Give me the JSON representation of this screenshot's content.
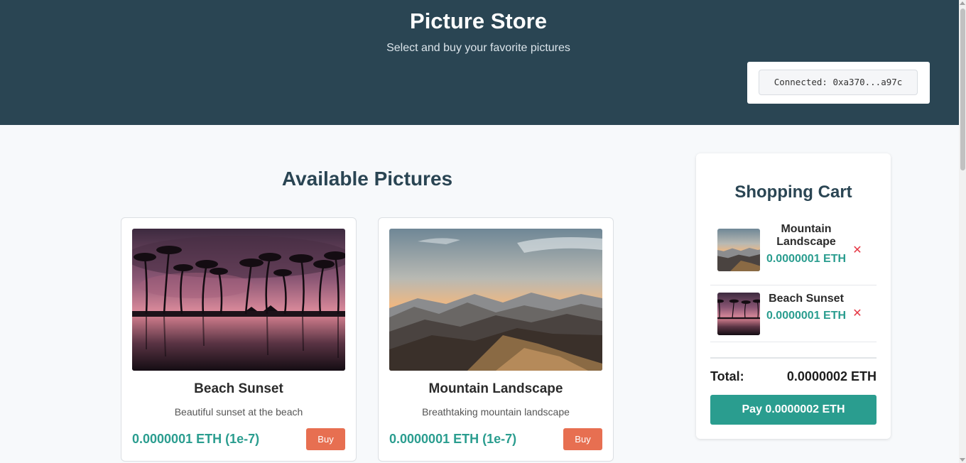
{
  "header": {
    "title": "Picture Store",
    "subtitle": "Select and buy your favorite pictures",
    "wallet_status": "Connected: 0xa370...a97c"
  },
  "catalog": {
    "title": "Available Pictures",
    "items": [
      {
        "name": "Beach Sunset",
        "description": "Beautiful sunset at the beach",
        "price": "0.0000001 ETH (1e-7)",
        "buy_label": "Buy"
      },
      {
        "name": "Mountain Landscape",
        "description": "Breathtaking mountain landscape",
        "price": "0.0000001 ETH (1e-7)",
        "buy_label": "Buy"
      }
    ]
  },
  "cart": {
    "title": "Shopping Cart",
    "items": [
      {
        "name": "Mountain Landscape",
        "price": "0.0000001 ETH",
        "remove_label": "✕"
      },
      {
        "name": "Beach Sunset",
        "price": "0.0000001 ETH",
        "remove_label": "✕"
      }
    ],
    "total_label": "Total:",
    "total_value": "0.0000002 ETH",
    "pay_label": "Pay 0.0000002 ETH"
  },
  "colors": {
    "header_bg": "#2a4553",
    "accent_teal": "#2a9d8f",
    "buy_orange": "#e76f51",
    "remove_red": "#e63946"
  }
}
